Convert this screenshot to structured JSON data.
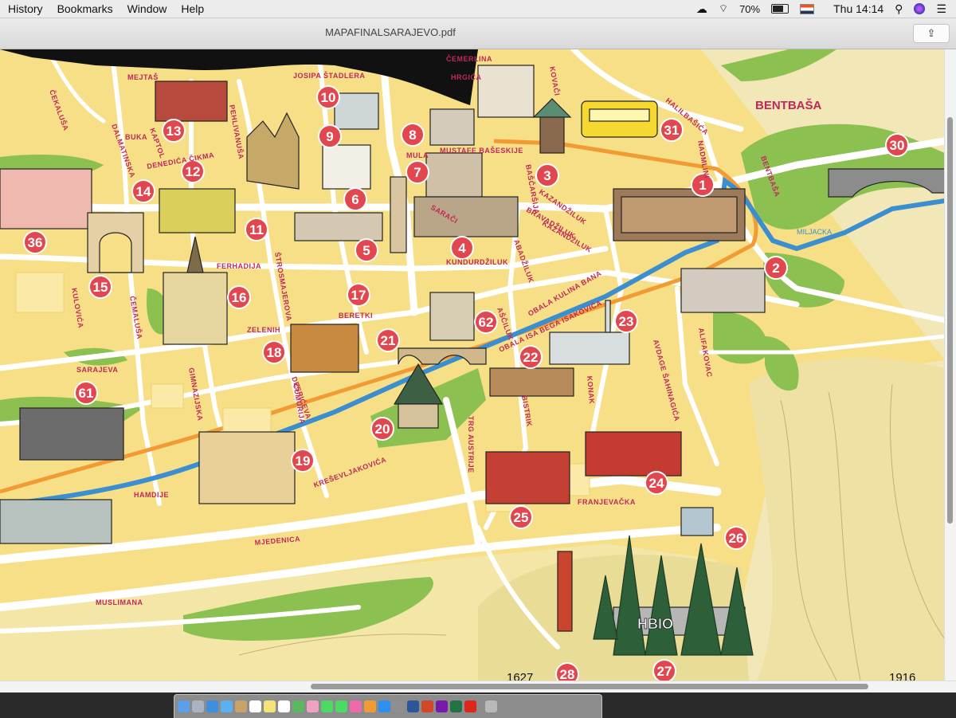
{
  "menubar": {
    "items": [
      "History",
      "Bookmarks",
      "Window",
      "Help"
    ],
    "battery": "70%",
    "clock": "Thu 14:14"
  },
  "window": {
    "title": "MAPAFINALSARAJEVO.pdf"
  },
  "map": {
    "district_label": "BENTBAŠA",
    "river_label": "MILJACKA",
    "streets": [
      "ČEKALUŠA",
      "MEJTAŠ",
      "JOSIPA ŠTADLERA",
      "DALMATINSKA",
      "KAPTOL",
      "PEHLIVANUŠA",
      "BUKA",
      "ČEMERLINA",
      "HRGIĆA",
      "KOVAČI",
      "HALILBAŠIĆA",
      "NADMLINI",
      "BENTBAŠA",
      "MULA",
      "MUSTAFE BAŠESKIJE",
      "BAŠČARŠIJA",
      "KAZANDŽILUK",
      "BRAVADŽILUK",
      "SARAČI",
      "ABADŽILUK",
      "KUNDURDŽILUK",
      "FERHADIJA",
      "ŠTROSMAJEROVA",
      "KULOVIĆA",
      "ČEMALUŠA",
      "ZELENIH",
      "BERETKI",
      "AŠČILUK",
      "OBALA KULINA BANA",
      "OBALA ISA BEGA ISAKOVIĆA",
      "ALIFAKOVAC",
      "SARAJEVA",
      "GIMNAZIJSKA",
      "DESPIĆEVA",
      "ČUMURIJA",
      "BISTRIK",
      "TRG AUSTRIJE",
      "KONAK",
      "AVDAGE ŠAHINAGIĆA",
      "KREŠEVLJAKOVIĆA",
      "HAMDIJE",
      "FRANJEVAČKA",
      "MJEDENICA",
      "MUSLIMANA",
      "DENEDIĆA ČIKMA",
      "KAZANDŽILUK"
    ],
    "markers": [
      "1",
      "2",
      "3",
      "4",
      "5",
      "6",
      "7",
      "8",
      "9",
      "10",
      "11",
      "12",
      "13",
      "14",
      "15",
      "16",
      "17",
      "18",
      "19",
      "20",
      "21",
      "22",
      "23",
      "24",
      "25",
      "26",
      "27",
      "28",
      "30",
      "31",
      "36",
      "61",
      "62"
    ],
    "elevations": [
      "1627",
      "1916"
    ],
    "sign_text": "HBIO"
  },
  "colors": {
    "land": "#f6df86",
    "road": "#ffffff",
    "park": "#8cc152",
    "river": "#3b8fd0",
    "tram": "#f29a34",
    "marker": "#e2474f",
    "street_text": "#c0285a"
  },
  "dock": {
    "icons": [
      "finder-icon",
      "launchpad-icon",
      "safari-icon",
      "mail-icon",
      "contacts-icon",
      "calendar-icon",
      "notes-icon",
      "reminders-icon",
      "maps-icon",
      "photos-icon",
      "messages-icon",
      "facetime-icon",
      "itunes-icon",
      "ibooks-icon",
      "appstore-icon",
      "preferences-icon",
      "word-icon",
      "powerpoint-icon",
      "onenote-icon",
      "excel-icon",
      "acrobat-icon",
      "trash-icon"
    ]
  }
}
